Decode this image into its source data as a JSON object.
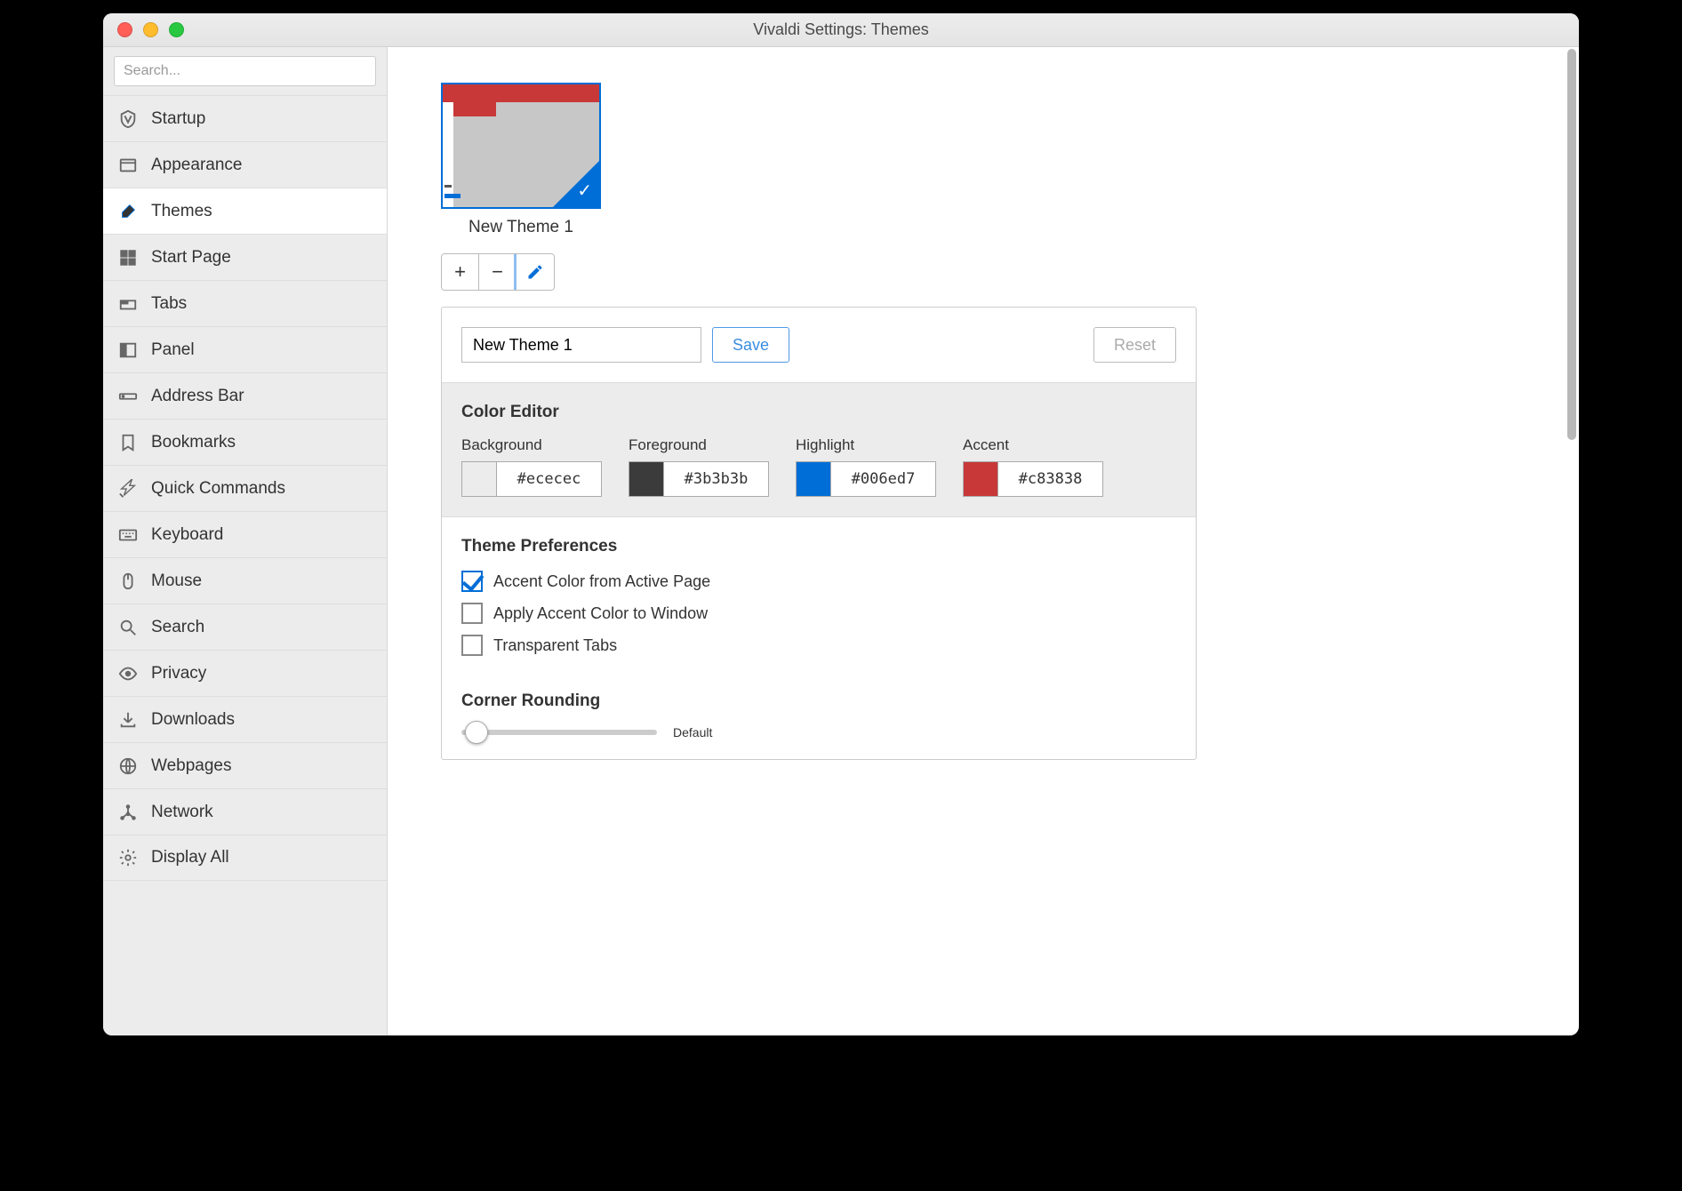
{
  "window": {
    "title": "Vivaldi Settings: Themes"
  },
  "search": {
    "placeholder": "Search..."
  },
  "sidebar": {
    "items": [
      {
        "label": "Startup",
        "icon": "vivaldi"
      },
      {
        "label": "Appearance",
        "icon": "window"
      },
      {
        "label": "Themes",
        "icon": "brush",
        "active": true
      },
      {
        "label": "Start Page",
        "icon": "grid"
      },
      {
        "label": "Tabs",
        "icon": "tabs"
      },
      {
        "label": "Panel",
        "icon": "panel"
      },
      {
        "label": "Address Bar",
        "icon": "addressbar"
      },
      {
        "label": "Bookmarks",
        "icon": "bookmark"
      },
      {
        "label": "Quick Commands",
        "icon": "quick"
      },
      {
        "label": "Keyboard",
        "icon": "keyboard"
      },
      {
        "label": "Mouse",
        "icon": "mouse"
      },
      {
        "label": "Search",
        "icon": "search"
      },
      {
        "label": "Privacy",
        "icon": "eye"
      },
      {
        "label": "Downloads",
        "icon": "download"
      },
      {
        "label": "Webpages",
        "icon": "globe"
      },
      {
        "label": "Network",
        "icon": "network"
      },
      {
        "label": "Display All",
        "icon": "gear"
      }
    ]
  },
  "theme": {
    "name": "New Theme 1",
    "save_label": "Save",
    "reset_label": "Reset"
  },
  "toolbar": {
    "add": "+",
    "remove": "−",
    "edit": "✎"
  },
  "color_editor": {
    "heading": "Color Editor",
    "fields": [
      {
        "label": "Background",
        "hex": "#ececec"
      },
      {
        "label": "Foreground",
        "hex": "#3b3b3b"
      },
      {
        "label": "Highlight",
        "hex": "#006ed7"
      },
      {
        "label": "Accent",
        "hex": "#c83838"
      }
    ]
  },
  "prefs": {
    "heading": "Theme Preferences",
    "items": [
      {
        "label": "Accent Color from Active Page",
        "checked": true
      },
      {
        "label": "Apply Accent Color to Window",
        "checked": false
      },
      {
        "label": "Transparent Tabs",
        "checked": false
      }
    ]
  },
  "rounding": {
    "heading": "Corner Rounding",
    "value_label": "Default"
  }
}
